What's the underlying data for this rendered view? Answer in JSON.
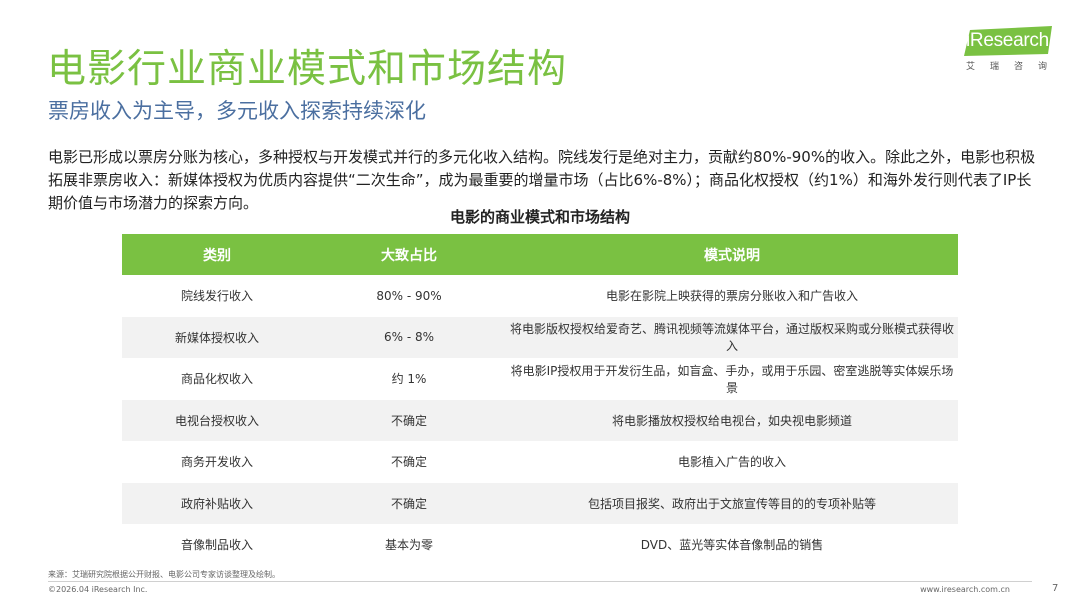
{
  "header": {
    "title": "电影行业商业模式和市场结构",
    "subtitle": "票房收入为主导，多元收入探索持续深化"
  },
  "logo": {
    "text": "iResearch",
    "cn": "艾瑞咨询",
    "colors": {
      "green": "#7ac142",
      "white": "#ffffff"
    }
  },
  "intro": "电影已形成以票房分账为核心，多种授权与开发模式并行的多元化收入结构。院线发行是绝对主力，贡献约80%-90%的收入。除此之外，电影也积极拓展非票房收入：新媒体授权为优质内容提供“二次生命”，成为最重要的增量市场（占比6%-8%）；商品化权授权（约1%）和海外发行则代表了IP长期价值与市场潜力的探索方向。",
  "table": {
    "title": "电影的商业模式和市场结构",
    "headers": [
      "类别",
      "大致占比",
      "模式说明"
    ],
    "rows": [
      [
        "院线发行收入",
        "80% - 90%",
        "电影在影院上映获得的票房分账收入和广告收入"
      ],
      [
        "新媒体授权收入",
        "6% - 8%",
        "将电影版权授权给爱奇艺、腾讯视频等流媒体平台，通过版权采购或分账模式获得收入"
      ],
      [
        "商品化权收入",
        "约 1%",
        "将电影IP授权用于开发衍生品，如盲盒、手办，或用于乐园、密室逃脱等实体娱乐场景"
      ],
      [
        "电视台授权收入",
        "不确定",
        "将电影播放权授权给电视台，如央视电影频道"
      ],
      [
        "商务开发收入",
        "不确定",
        "电影植入广告的收入"
      ],
      [
        "政府补贴收入",
        "不确定",
        "包括项目报奖、政府出于文旅宣传等目的的专项补贴等"
      ],
      [
        "音像制品收入",
        "基本为零",
        "DVD、蓝光等实体音像制品的销售"
      ]
    ]
  },
  "footer": {
    "source": "来源：艾瑞研究院根据公开财报、电影公司专家访谈整理及绘制。",
    "copyright": "©2026.04 iResearch Inc.",
    "website": "www.iresearch.com.cn",
    "page": "7"
  },
  "colors": {
    "accent": "#7ac142",
    "subtitle": "#4b6fa0",
    "row_alt": "#f2f2f2"
  }
}
